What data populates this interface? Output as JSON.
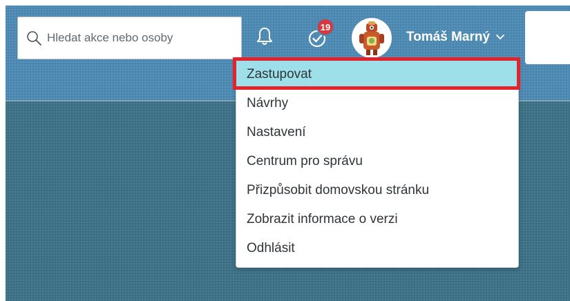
{
  "header": {
    "search": {
      "placeholder": "Hledat akce nebo osoby",
      "icon": "search-icon"
    },
    "notifications": {
      "icon": "bell-icon"
    },
    "tasks": {
      "icon": "check-circle-icon",
      "badge_count": "19",
      "badge_color": "#d7373f"
    },
    "user": {
      "name": "Tomáš Marný",
      "avatar": "robot-avatar",
      "chevron_icon": "chevron-down-icon"
    }
  },
  "menu": {
    "items": [
      {
        "label": "Zastupovat",
        "active": true
      },
      {
        "label": "Návrhy"
      },
      {
        "label": "Nastavení"
      },
      {
        "label": "Centrum pro správu"
      },
      {
        "label": "Přizpůsobit domovskou stránku"
      },
      {
        "label": "Zobrazit informace o verzi"
      },
      {
        "label": "Odhlásit"
      }
    ]
  },
  "colors": {
    "header_blue": "#4a88b2",
    "background_teal": "#3b6f85",
    "active_item": "#9ee0ea",
    "highlight_border": "#e4222c"
  }
}
